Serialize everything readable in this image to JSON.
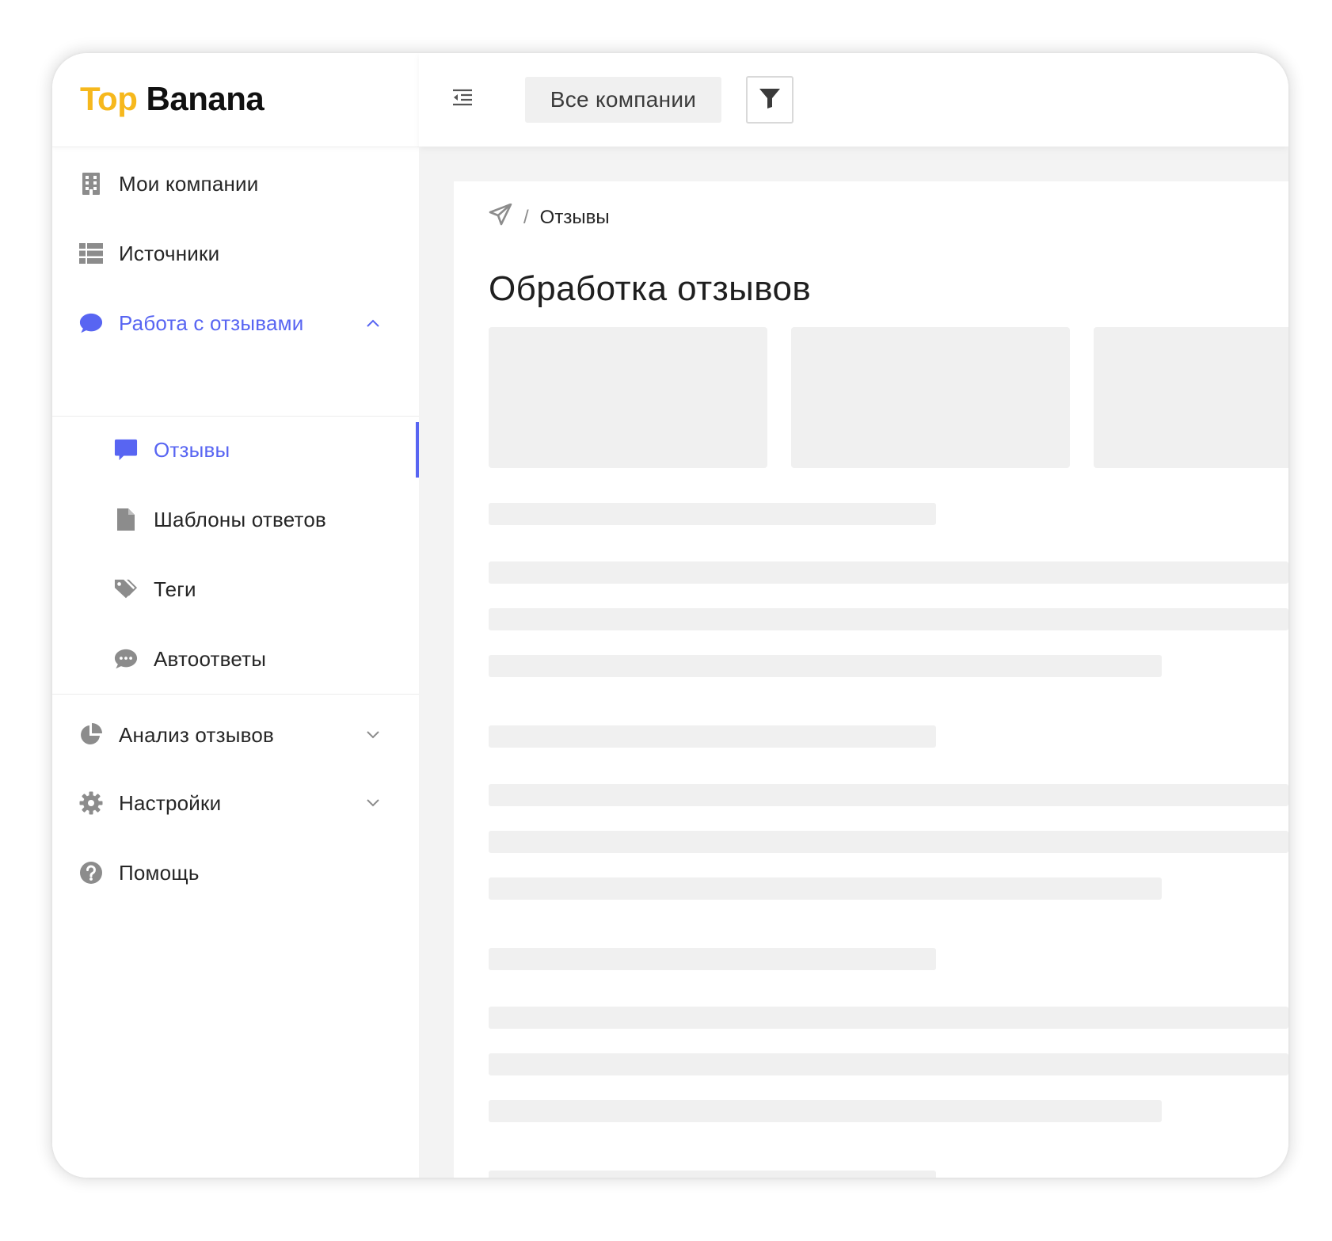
{
  "brand": {
    "logo_part1": "Top",
    "logo_part2": "Banana",
    "color_accent": "#f6b81d"
  },
  "header": {
    "company_selector": "Все компании",
    "filter_icon": "filter-icon",
    "menu_icon": "menu-fold-icon"
  },
  "sidebar": {
    "accent_color": "#5865f2",
    "items": [
      {
        "label": "Мои компании",
        "icon": "building-icon"
      },
      {
        "label": "Источники",
        "icon": "table-list-icon"
      },
      {
        "label": "Работа с отзывами",
        "icon": "chat-bubble-icon",
        "expanded": true
      },
      {
        "label": "Отзывы",
        "icon": "message-icon",
        "active": true
      },
      {
        "label": "Шаблоны ответов",
        "icon": "file-icon"
      },
      {
        "label": "Теги",
        "icon": "tags-icon"
      },
      {
        "label": "Автоответы",
        "icon": "comment-dots-icon"
      },
      {
        "label": "Анализ отзывов",
        "icon": "pie-chart-icon"
      },
      {
        "label": "Настройки",
        "icon": "gear-icon"
      },
      {
        "label": "Помощь",
        "icon": "question-circle-icon"
      }
    ]
  },
  "main": {
    "breadcrumb": {
      "current": "Отзывы",
      "separator": "/"
    },
    "title": "Обработка отзывов"
  }
}
